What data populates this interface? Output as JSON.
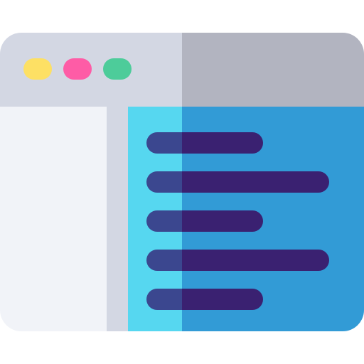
{
  "icon": {
    "name": "browser-window-code-icon",
    "colors": {
      "titlebar_light": "#d3d7e3",
      "titlebar_dark": "#b2b4c0",
      "sidebar": "#f1f3f8",
      "divider": "#d3d7e3",
      "content_light": "#56d7f0",
      "content_dark": "#329bd6",
      "line_light": "#3b478f",
      "line_dark": "#3a2171",
      "dot_yellow": "#fde064",
      "dot_pink": "#fe5ca6",
      "dot_green": "#4dcc9a"
    },
    "window_controls": [
      "yellow-dot",
      "pink-dot",
      "green-dot"
    ],
    "text_lines": [
      {
        "length": "short"
      },
      {
        "length": "long"
      },
      {
        "length": "short"
      },
      {
        "length": "long"
      },
      {
        "length": "short"
      }
    ]
  }
}
